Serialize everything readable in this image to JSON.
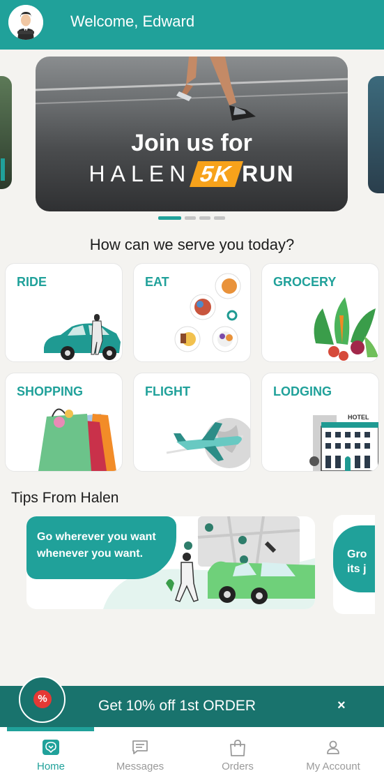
{
  "header": {
    "welcome": "Welcome, Edward",
    "avatar_icon": "user-avatar-icon"
  },
  "banner": {
    "line1": "Join us for",
    "brand": "HALEN",
    "highlight": "5K",
    "suffix": "RUN",
    "slides_total": 4,
    "active_slide": 1
  },
  "services": {
    "title": "How can we serve you today?",
    "items": [
      {
        "label": "RIDE",
        "icon": "car-icon"
      },
      {
        "label": "EAT",
        "icon": "food-plates-icon"
      },
      {
        "label": "GROCERY",
        "icon": "vegetables-icon"
      },
      {
        "label": "SHOPPING",
        "icon": "shopping-bags-icon"
      },
      {
        "label": "FLIGHT",
        "icon": "airplane-icon"
      },
      {
        "label": "LODGING",
        "icon": "hotel-icon"
      }
    ]
  },
  "tips": {
    "title": "Tips From Halen",
    "cards": [
      {
        "text": "Go wherever you want whenever you want."
      },
      {
        "text_line1": "Gro",
        "text_line2": "its j"
      }
    ]
  },
  "promo": {
    "text": "Get 10% off 1st ORDER",
    "badge": "%",
    "close": "×"
  },
  "nav": {
    "items": [
      {
        "label": "Home",
        "icon": "home-icon",
        "active": true
      },
      {
        "label": "Messages",
        "icon": "messages-icon",
        "active": false
      },
      {
        "label": "Orders",
        "icon": "shopping-bag-icon",
        "active": false
      },
      {
        "label": "My Account",
        "icon": "account-icon",
        "active": false
      }
    ]
  },
  "colors": {
    "primary": "#20a19a",
    "promo": "#19736d",
    "accent": "#f7a21b",
    "badge": "#e53935"
  }
}
